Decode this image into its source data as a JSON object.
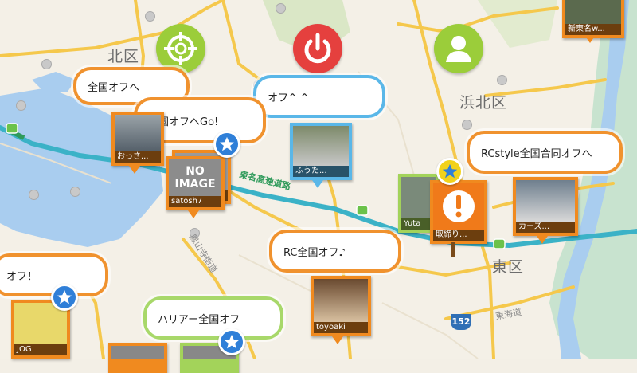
{
  "controls": {
    "target_icon": "target-crosshair-icon",
    "power_icon": "power-icon",
    "profile_icon": "user-profile-icon",
    "colors": {
      "target": "#9bcd3a",
      "power": "#e5403e",
      "profile": "#9bcd3a"
    }
  },
  "labels": {
    "kita_ku": "北区",
    "hamakita_ku": "浜北区",
    "higashi_ku": "東区",
    "tomei": "東名高速道路",
    "hokkaido_road": "鳳山寺街道",
    "higashi_kaido": "東海道",
    "shin_tomei_top": "新東名w..."
  },
  "shields": {
    "route152_top": "152",
    "route152_bottom": "152"
  },
  "bubbles": [
    {
      "text": "全国オフへ"
    },
    {
      "text": "全国オフへGo!"
    },
    {
      "text": "オフ^ ^"
    },
    {
      "text": "RCstyle全国合同オフへ"
    },
    {
      "text": "RC全国オフ♪"
    },
    {
      "text": "オフ！"
    },
    {
      "text": "ハリアー全国オフ"
    }
  ],
  "pins": [
    {
      "caption": "おっさ..."
    },
    {
      "caption": "satosh7",
      "noimage": "NO IMAGE"
    },
    {
      "caption": "ふうた..."
    },
    {
      "caption": "Yuta"
    },
    {
      "caption": "取締り..."
    },
    {
      "caption": "カーズ..."
    },
    {
      "caption": "toyoaki"
    },
    {
      "caption": "JOG"
    }
  ]
}
